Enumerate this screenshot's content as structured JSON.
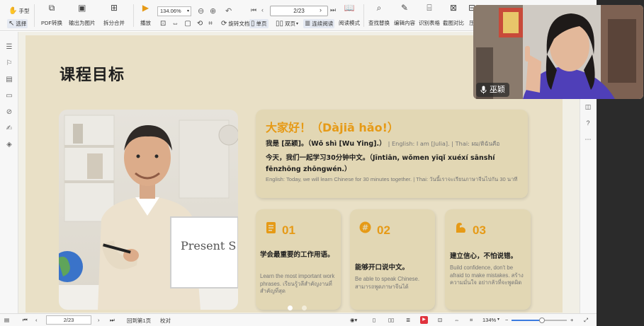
{
  "toolbar": {
    "hand_label": "手型",
    "select_label": "选择",
    "pdf_convert_label": "PDF转换",
    "export_image_label": "输出为图片",
    "split_merge_label": "拆分合并",
    "play_label": "播放",
    "zoom_value": "134.06%",
    "rotate_label": "旋转文档",
    "single_page_label": "单页",
    "double_page_label": "双页",
    "continuous_label": "连续阅读",
    "read_mode_label": "阅读模式",
    "find_replace_label": "查找替换",
    "edit_content_label": "编辑内容",
    "ocr_table_label": "识别表格",
    "screenshot_compare_label": "截图对比",
    "compress_label": "压",
    "page_indicator": "2/23"
  },
  "slide": {
    "title": "课程目标",
    "greeting": {
      "title": "大家好！（Dàjiā hǎo!）",
      "line1_cn": "我是 [巫颖]。（Wǒ shì [Wu Ying].）",
      "line1_en": "| English: I am [Julia]. | Thai: ผม/ดิฉันคือ",
      "line2": "今天，我们一起学习30分钟中文。（Jīntiān, wǒmen yīqǐ xuéxí sānshí fēnzhōng zhōngwén.）",
      "line3": "English: Today, we will learn Chinese for 30 minutes together. | Thai: วันนี้เราจะเรียนภาษาจีนไปกัน 30 นาที"
    },
    "cards": [
      {
        "number": "01",
        "icon": "document-icon",
        "heading": "学会最重要的工作用语。",
        "sub": "Learn the most important work phrases. เรียนรู้วลีสำคัญงานที่สำคัญที่สุด"
      },
      {
        "number": "02",
        "icon": "hash-icon",
        "heading": "能够开口说中文。",
        "sub": "Be able to speak Chinese. สามารถพูดภาษาจีนได้"
      },
      {
        "number": "03",
        "icon": "flexed-arm-icon",
        "heading": "建立信心，不怕说错。",
        "sub": "Build confidence, don't be afraid to make mistakes. สร้างความมั่นใจ อย่ากลัวที่จะพูดผิด"
      }
    ],
    "photo_whiteboard_text": "Present S"
  },
  "statusbar": {
    "page_value": "2/23",
    "back_to_first_label": "回到第1页",
    "proofread_label": "校对",
    "zoom_percent": "134%",
    "zoom_slider_fraction": 0.55
  },
  "webcam": {
    "name_label": "巫颖"
  },
  "colors": {
    "accent": "#e69a16",
    "slide_bg": "#e9e0c6",
    "card_bg": "#e2d7b4",
    "doc_bg": "#f1efe6"
  }
}
